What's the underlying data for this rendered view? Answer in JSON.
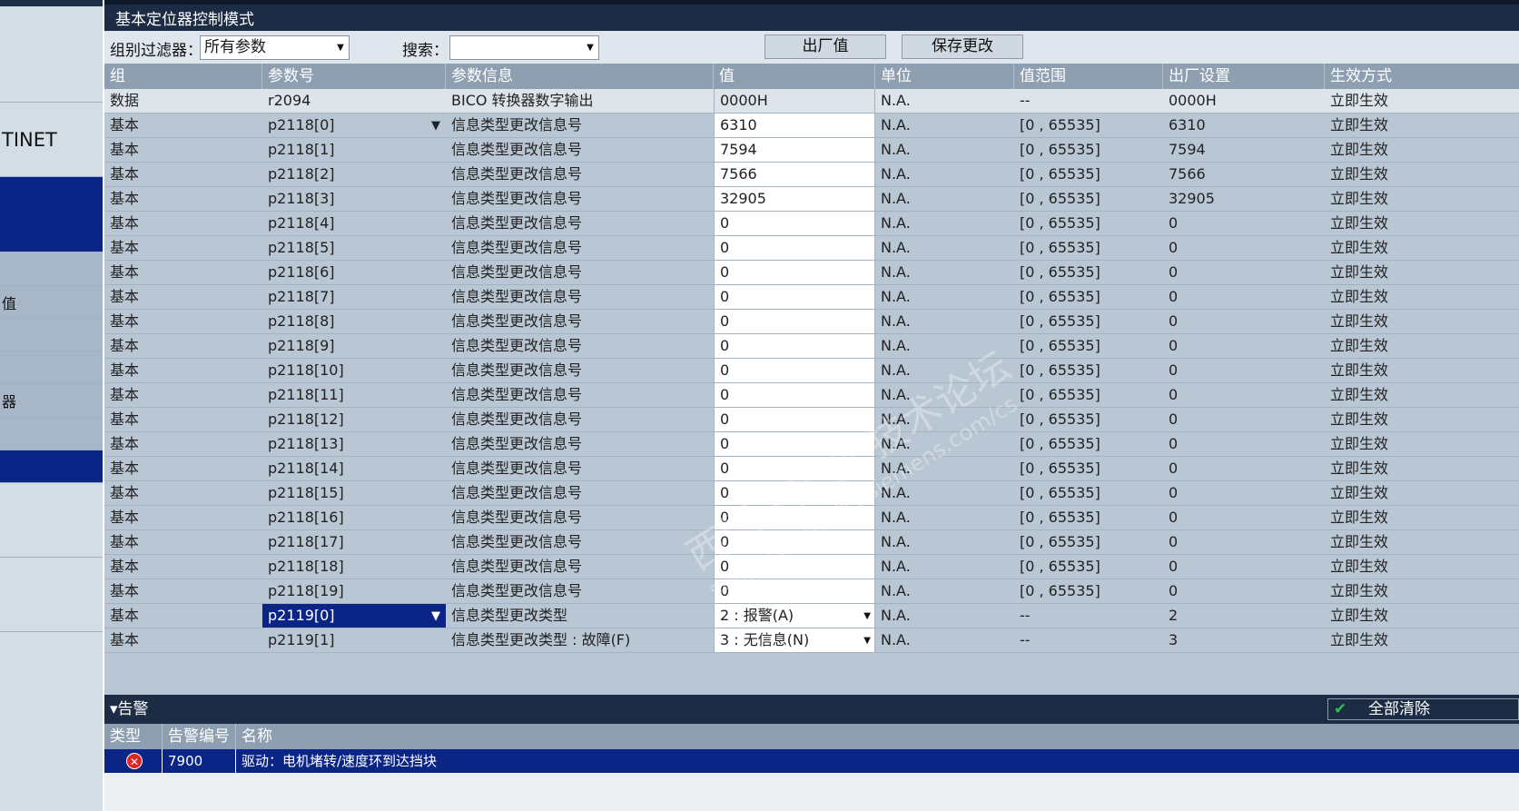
{
  "left_nav": {
    "items": [
      {
        "label": ""
      },
      {
        "label": "TINET"
      },
      {
        "label": ""
      },
      {
        "label": ""
      },
      {
        "label": "值"
      },
      {
        "label": ""
      },
      {
        "label": ""
      },
      {
        "label": "器"
      },
      {
        "label": ""
      },
      {
        "label": ""
      },
      {
        "label": ""
      },
      {
        "label": ""
      },
      {
        "label": ""
      }
    ]
  },
  "title_bar": {
    "title": "基本定位器控制模式"
  },
  "toolbar": {
    "group_filter_label": "组别过滤器：",
    "group_filter_value": "所有参数",
    "search_label": "搜索：",
    "search_value": "",
    "factory_button": "出厂值",
    "save_button": "保存更改"
  },
  "table": {
    "columns": [
      "组",
      "参数号",
      "参数信息",
      "值",
      "单位",
      "值范围",
      "出厂设置",
      "生效方式"
    ],
    "rows": [
      {
        "group": "数据",
        "param": "r2094",
        "info": "BICO 转换器数字输出",
        "value": "0000H",
        "unit": "N.A.",
        "range": "--",
        "factory": "0000H",
        "effect": "立即生效"
      },
      {
        "group": "基本",
        "param": "p2118[0]",
        "info": "信息类型更改信息号",
        "value": "6310",
        "unit": "N.A.",
        "range": "[0 , 65535]",
        "factory": "6310",
        "effect": "立即生效"
      },
      {
        "group": "基本",
        "param": "p2118[1]",
        "info": "信息类型更改信息号",
        "value": "7594",
        "unit": "N.A.",
        "range": "[0 , 65535]",
        "factory": "7594",
        "effect": "立即生效"
      },
      {
        "group": "基本",
        "param": "p2118[2]",
        "info": "信息类型更改信息号",
        "value": "7566",
        "unit": "N.A.",
        "range": "[0 , 65535]",
        "factory": "7566",
        "effect": "立即生效"
      },
      {
        "group": "基本",
        "param": "p2118[3]",
        "info": "信息类型更改信息号",
        "value": "32905",
        "unit": "N.A.",
        "range": "[0 , 65535]",
        "factory": "32905",
        "effect": "立即生效"
      },
      {
        "group": "基本",
        "param": "p2118[4]",
        "info": "信息类型更改信息号",
        "value": "0",
        "unit": "N.A.",
        "range": "[0 , 65535]",
        "factory": "0",
        "effect": "立即生效"
      },
      {
        "group": "基本",
        "param": "p2118[5]",
        "info": "信息类型更改信息号",
        "value": "0",
        "unit": "N.A.",
        "range": "[0 , 65535]",
        "factory": "0",
        "effect": "立即生效"
      },
      {
        "group": "基本",
        "param": "p2118[6]",
        "info": "信息类型更改信息号",
        "value": "0",
        "unit": "N.A.",
        "range": "[0 , 65535]",
        "factory": "0",
        "effect": "立即生效"
      },
      {
        "group": "基本",
        "param": "p2118[7]",
        "info": "信息类型更改信息号",
        "value": "0",
        "unit": "N.A.",
        "range": "[0 , 65535]",
        "factory": "0",
        "effect": "立即生效"
      },
      {
        "group": "基本",
        "param": "p2118[8]",
        "info": "信息类型更改信息号",
        "value": "0",
        "unit": "N.A.",
        "range": "[0 , 65535]",
        "factory": "0",
        "effect": "立即生效"
      },
      {
        "group": "基本",
        "param": "p2118[9]",
        "info": "信息类型更改信息号",
        "value": "0",
        "unit": "N.A.",
        "range": "[0 , 65535]",
        "factory": "0",
        "effect": "立即生效"
      },
      {
        "group": "基本",
        "param": "p2118[10]",
        "info": "信息类型更改信息号",
        "value": "0",
        "unit": "N.A.",
        "range": "[0 , 65535]",
        "factory": "0",
        "effect": "立即生效"
      },
      {
        "group": "基本",
        "param": "p2118[11]",
        "info": "信息类型更改信息号",
        "value": "0",
        "unit": "N.A.",
        "range": "[0 , 65535]",
        "factory": "0",
        "effect": "立即生效"
      },
      {
        "group": "基本",
        "param": "p2118[12]",
        "info": "信息类型更改信息号",
        "value": "0",
        "unit": "N.A.",
        "range": "[0 , 65535]",
        "factory": "0",
        "effect": "立即生效"
      },
      {
        "group": "基本",
        "param": "p2118[13]",
        "info": "信息类型更改信息号",
        "value": "0",
        "unit": "N.A.",
        "range": "[0 , 65535]",
        "factory": "0",
        "effect": "立即生效"
      },
      {
        "group": "基本",
        "param": "p2118[14]",
        "info": "信息类型更改信息号",
        "value": "0",
        "unit": "N.A.",
        "range": "[0 , 65535]",
        "factory": "0",
        "effect": "立即生效"
      },
      {
        "group": "基本",
        "param": "p2118[15]",
        "info": "信息类型更改信息号",
        "value": "0",
        "unit": "N.A.",
        "range": "[0 , 65535]",
        "factory": "0",
        "effect": "立即生效"
      },
      {
        "group": "基本",
        "param": "p2118[16]",
        "info": "信息类型更改信息号",
        "value": "0",
        "unit": "N.A.",
        "range": "[0 , 65535]",
        "factory": "0",
        "effect": "立即生效"
      },
      {
        "group": "基本",
        "param": "p2118[17]",
        "info": "信息类型更改信息号",
        "value": "0",
        "unit": "N.A.",
        "range": "[0 , 65535]",
        "factory": "0",
        "effect": "立即生效"
      },
      {
        "group": "基本",
        "param": "p2118[18]",
        "info": "信息类型更改信息号",
        "value": "0",
        "unit": "N.A.",
        "range": "[0 , 65535]",
        "factory": "0",
        "effect": "立即生效"
      },
      {
        "group": "基本",
        "param": "p2118[19]",
        "info": "信息类型更改信息号",
        "value": "0",
        "unit": "N.A.",
        "range": "[0 , 65535]",
        "factory": "0",
        "effect": "立即生效"
      },
      {
        "group": "基本",
        "param": "p2119[0]",
        "info": "信息类型更改类型",
        "value": "2 : 报警(A)",
        "unit": "N.A.",
        "range": "--",
        "factory": "2",
        "effect": "立即生效"
      },
      {
        "group": "基本",
        "param": "p2119[1]",
        "info": "信息类型更改类型 : 故障(F)",
        "value": "3 : 无信息(N)",
        "unit": "N.A.",
        "range": "--",
        "factory": "3",
        "effect": "立即生效"
      }
    ]
  },
  "watermark": {
    "line1": "西门子工业 技术论坛",
    "line2": "support.industry.siemens.com/cs"
  },
  "alarms": {
    "title": "告警",
    "clear_all": "全部清除",
    "columns": [
      "类型",
      "告警编号",
      "名称"
    ],
    "rows": [
      {
        "type_icon": "error-icon",
        "number": "7900",
        "name": "驱动：电机堵转/速度环到达挡块"
      }
    ]
  },
  "colors": {
    "title_bar": "#1b2c44",
    "table_body": "#b9c6d3",
    "header": "#8e9fb2",
    "selection": "#0b2587",
    "error": "#e12525"
  }
}
